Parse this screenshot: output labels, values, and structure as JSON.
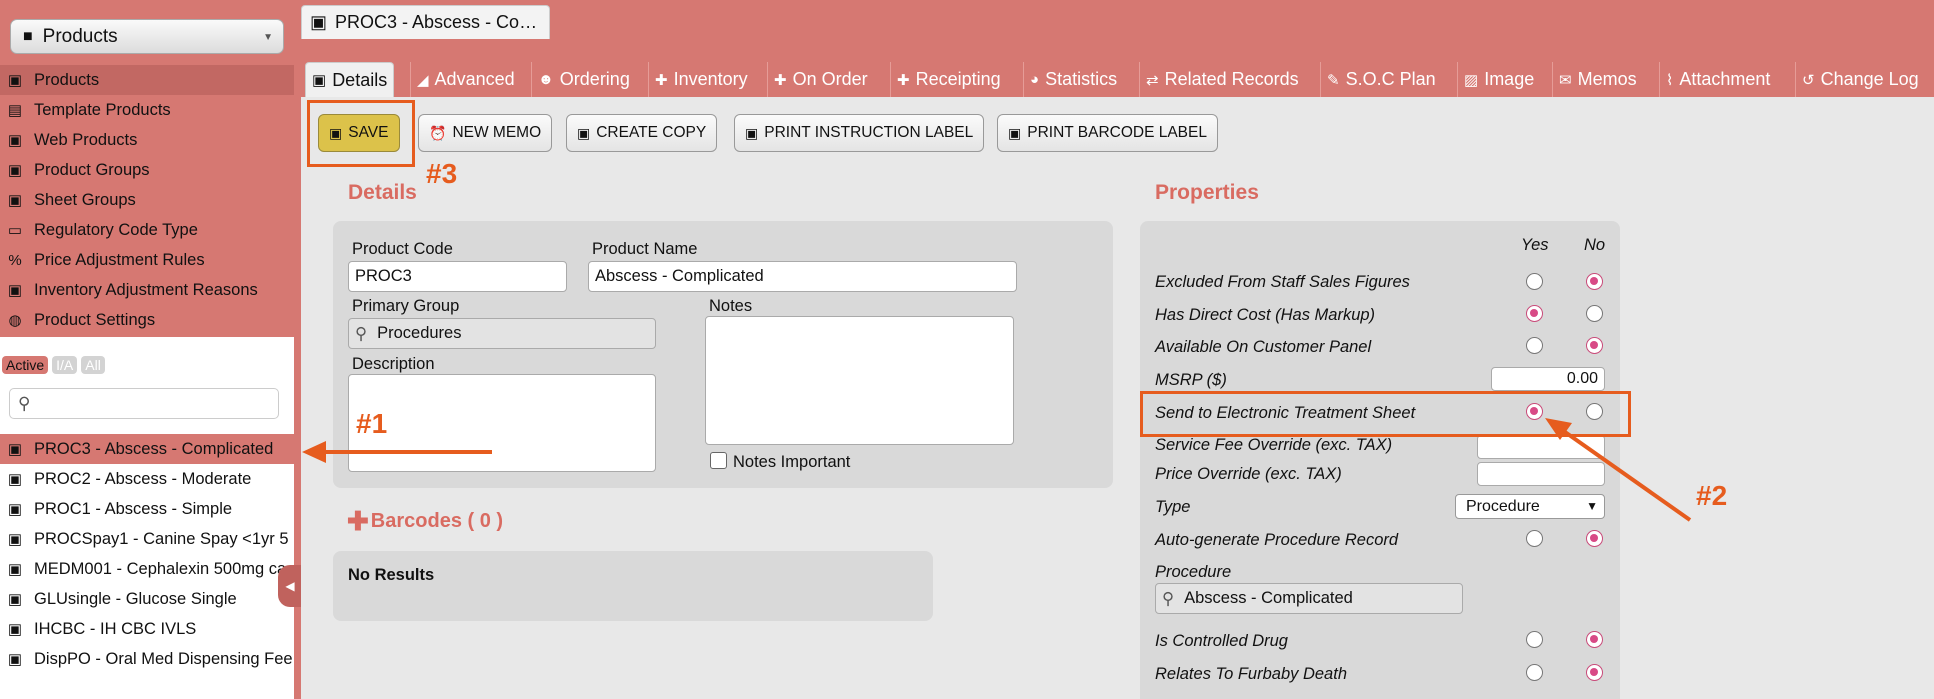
{
  "sidebar": {
    "module_select": "Products",
    "nav": [
      {
        "label": "Products",
        "icon": "box-icon"
      },
      {
        "label": "Template Products",
        "icon": "template-icon"
      },
      {
        "label": "Web Products",
        "icon": "web-icon"
      },
      {
        "label": "Product Groups",
        "icon": "group-icon"
      },
      {
        "label": "Sheet Groups",
        "icon": "sheet-icon"
      },
      {
        "label": "Regulatory Code Type",
        "icon": "clipboard-icon"
      },
      {
        "label": "Price Adjustment Rules",
        "icon": "percent-icon"
      },
      {
        "label": "Inventory Adjustment Reasons",
        "icon": "box-icon"
      },
      {
        "label": "Product Settings",
        "icon": "globe-icon"
      }
    ],
    "filter_tabs": [
      "Active",
      "I/A",
      "All"
    ],
    "results": [
      "PROC3 - Abscess - Complicated",
      "PROC2 - Abscess - Moderate",
      "PROC1 - Abscess - Simple",
      "PROCSpay1 - Canine Spay <1yr 5",
      "MEDM001 - Cephalexin 500mg ca",
      "GLUsingle - Glucose Single",
      "IHCBC - IH CBC IVLS",
      "DispPO - Oral Med Dispensing Fee"
    ]
  },
  "doc_tab": "PROC3 - Abscess - Co…",
  "tabs": [
    "Details",
    "Advanced",
    "Ordering",
    "Inventory",
    "On Order",
    "Receipting",
    "Statistics",
    "Related Records",
    "S.O.C Plan",
    "Image",
    "Memos",
    "Attachment",
    "Change Log"
  ],
  "toolbar": {
    "save": "SAVE",
    "new_memo": "NEW MEMO",
    "create_copy": "CREATE COPY",
    "print_instruction": "PRINT INSTRUCTION LABEL",
    "print_barcode": "PRINT BARCODE LABEL"
  },
  "annotations": {
    "a1": "#1",
    "a2": "#2",
    "a3": "#3"
  },
  "details": {
    "title": "Details",
    "product_code_label": "Product Code",
    "product_code": "PROC3",
    "product_name_label": "Product Name",
    "product_name": "Abscess - Complicated",
    "primary_group_label": "Primary Group",
    "primary_group": "Procedures",
    "notes_label": "Notes",
    "description_label": "Description",
    "notes_important": "Notes Important",
    "barcodes": "Barcodes ( 0 )",
    "no_results": "No Results"
  },
  "properties": {
    "title": "Properties",
    "yes": "Yes",
    "no": "No",
    "excluded": "Excluded From Staff Sales Figures",
    "direct_cost": "Has Direct Cost (Has Markup)",
    "customer_panel": "Available On Customer Panel",
    "msrp_label": "MSRP ($)",
    "msrp_value": "0.00",
    "send_ets": "Send to Electronic Treatment Sheet",
    "service_fee": "Service Fee Override (exc. TAX)",
    "price_override": "Price Override (exc. TAX)",
    "type_label": "Type",
    "type_value": "Procedure",
    "auto_gen": "Auto-generate Procedure Record",
    "procedure_label": "Procedure",
    "procedure_value": "Abscess - Complicated",
    "controlled": "Is Controlled Drug",
    "furbaby": "Relates To Furbaby Death"
  },
  "colors": {
    "accent": "#d67872",
    "annotation": "#e65c1e",
    "save": "#dcc24a"
  }
}
